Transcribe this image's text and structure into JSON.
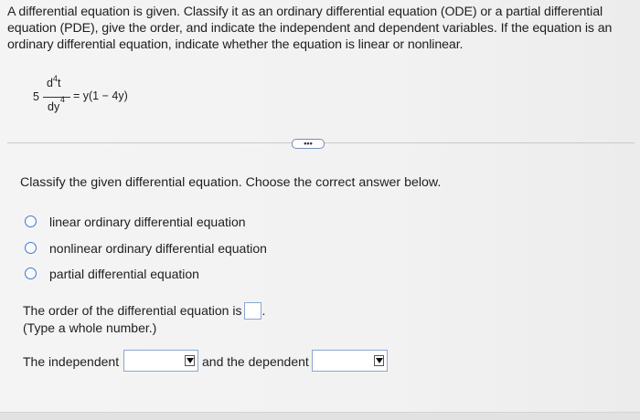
{
  "prompt": "A differential equation is given. Classify it as an ordinary differential equation (ODE) or a partial differential equation (PDE), give the order, and indicate the independent and dependent variables. If the equation is an ordinary differential equation, indicate whether the equation is linear or nonlinear.",
  "equation": {
    "coefficient": "5",
    "numerator": "d",
    "numerator_exp": "4",
    "numerator_var": "t",
    "denominator": "dy",
    "denominator_exp": "4",
    "rhs": "= y(1 − 4y)"
  },
  "more_button": "•••",
  "question": "Classify the given differential equation. Choose the correct answer below.",
  "options": [
    {
      "label": "linear ordinary differential equation",
      "selected": false
    },
    {
      "label": "nonlinear ordinary differential equation",
      "selected": false
    },
    {
      "label": "partial differential equation",
      "selected": false
    }
  ],
  "order": {
    "text": "The order of the differential equation is",
    "value": "",
    "hint": "(Type a whole number.)"
  },
  "variables": {
    "independent_label": "The independent",
    "independent_value": "",
    "dependent_label": "and the dependent",
    "dependent_value": ""
  },
  "colors": {
    "radio_border": "#3a7bd5",
    "input_border": "#8ba6d0"
  }
}
